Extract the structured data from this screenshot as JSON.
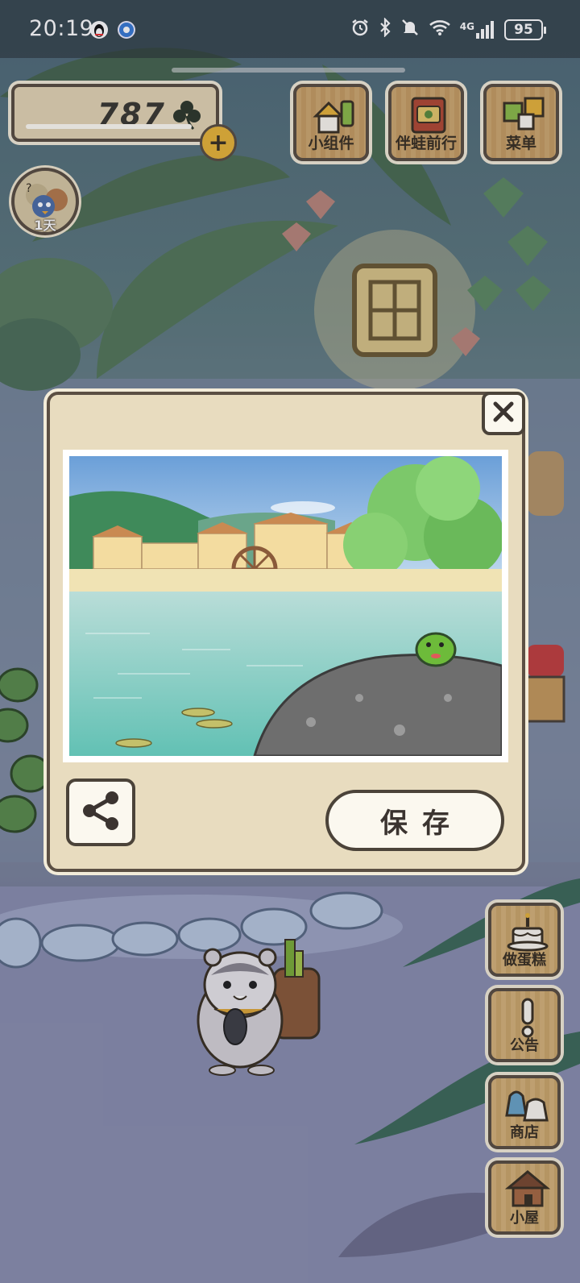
{
  "status_bar": {
    "time": "20:19",
    "network": "4G",
    "battery": "95"
  },
  "currency": {
    "clover_count": "787",
    "icon": "clover-icon"
  },
  "top_menu": [
    {
      "label": "小组件",
      "icon": "widget-icon"
    },
    {
      "label": "伴蛙前行",
      "icon": "journal-icon"
    },
    {
      "label": "菜单",
      "icon": "menu-icon"
    }
  ],
  "day_badge": {
    "label": "1天"
  },
  "side_menu": [
    {
      "label": "做蛋糕",
      "icon": "cake-icon"
    },
    {
      "label": "公告",
      "icon": "exclamation-icon"
    },
    {
      "label": "商店",
      "icon": "shop-bag-icon"
    },
    {
      "label": "小屋",
      "icon": "house-icon"
    }
  ],
  "photo_dialog": {
    "save_label": "保存",
    "close_icon": "close-icon",
    "share_icon": "share-icon",
    "photo_subject": "frog-on-rock-by-river-town"
  },
  "colors": {
    "panel": "#e8dcbf",
    "border": "#4b4339",
    "accent": "#e9b63a"
  }
}
